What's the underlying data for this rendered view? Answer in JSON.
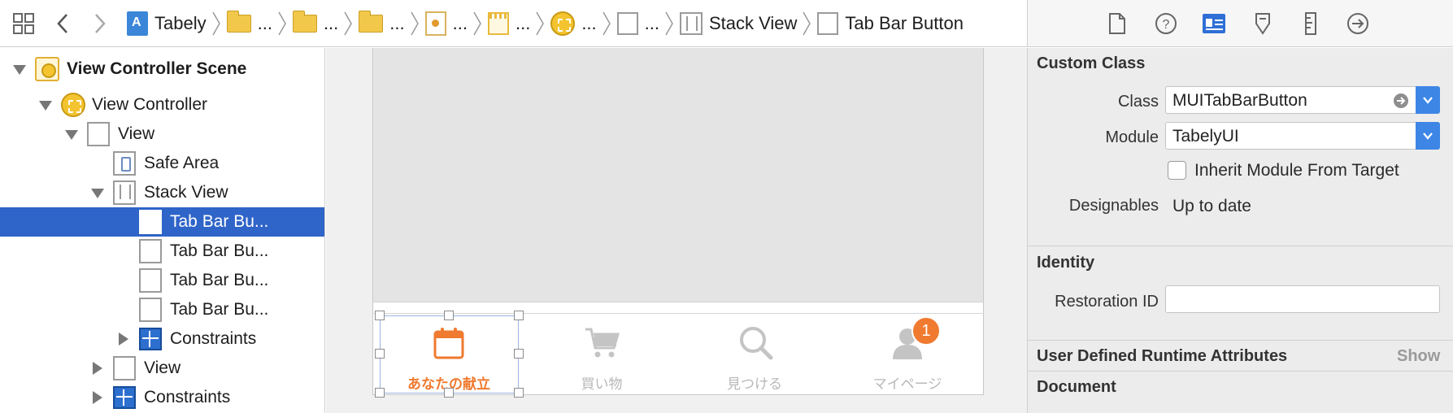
{
  "jumpbar": {
    "crumbs": [
      {
        "icon": "project-icon",
        "label": "Tabely"
      },
      {
        "icon": "folder-icon",
        "label": "..."
      },
      {
        "icon": "folder-icon",
        "label": "..."
      },
      {
        "icon": "folder-icon",
        "label": "..."
      },
      {
        "icon": "swift-file-icon",
        "label": "..."
      },
      {
        "icon": "storyboard-icon",
        "label": "..."
      },
      {
        "icon": "view-controller-icon",
        "label": "..."
      },
      {
        "icon": "view-icon",
        "label": "..."
      },
      {
        "icon": "stack-view-icon",
        "label": "Stack View"
      },
      {
        "icon": "view-icon",
        "label": "Tab Bar Button"
      }
    ]
  },
  "outline": {
    "rows": [
      {
        "label": "View Controller Scene",
        "bold": true
      },
      {
        "label": "View Controller"
      },
      {
        "label": "View"
      },
      {
        "label": "Safe Area"
      },
      {
        "label": "Stack View"
      },
      {
        "label": "Tab Bar Bu..."
      },
      {
        "label": "Tab Bar Bu..."
      },
      {
        "label": "Tab Bar Bu..."
      },
      {
        "label": "Tab Bar Bu..."
      },
      {
        "label": "Constraints"
      },
      {
        "label": "View"
      },
      {
        "label": "Constraints"
      }
    ]
  },
  "canvas": {
    "tabs": [
      {
        "label": "あなたの献立",
        "icon": "calendar-icon",
        "active": true
      },
      {
        "label": "買い物",
        "icon": "cart-icon"
      },
      {
        "label": "見つける",
        "icon": "magnifier-icon"
      },
      {
        "label": "マイページ",
        "icon": "person-icon"
      }
    ],
    "badge": "1",
    "accent_color": "#EF7A30"
  },
  "inspector": {
    "custom_class": {
      "title": "Custom Class",
      "class_label": "Class",
      "class_value": "MUITabBarButton",
      "module_label": "Module",
      "module_value": "TabelyUI",
      "inherit_label": "Inherit Module From Target",
      "designables_label": "Designables",
      "designables_value": "Up to date"
    },
    "identity": {
      "title": "Identity",
      "restoration_label": "Restoration ID",
      "restoration_value": ""
    },
    "runtime": {
      "title": "User Defined Runtime Attributes",
      "show": "Show"
    },
    "document": {
      "title": "Document"
    }
  }
}
